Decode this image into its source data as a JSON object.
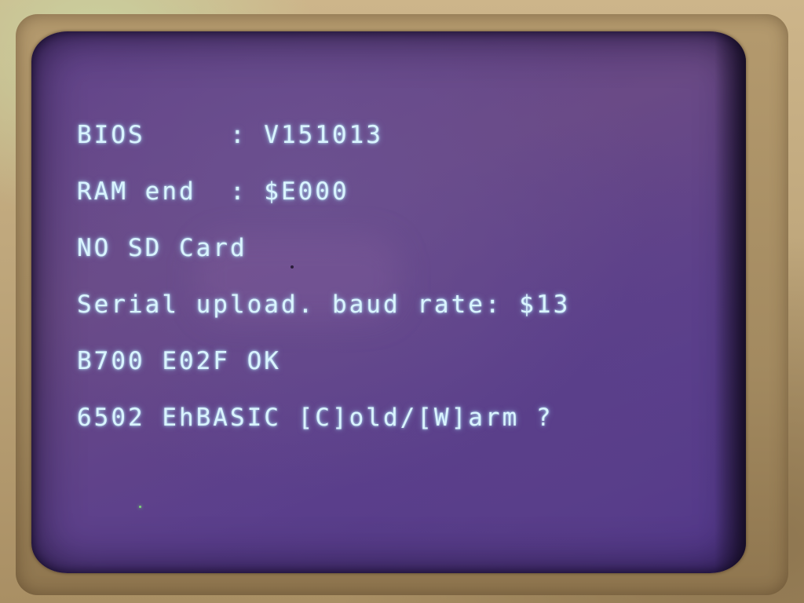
{
  "screen": {
    "lines": [
      "BIOS     : V151013",
      "RAM end  : $E000",
      "NO SD Card",
      "Serial upload. baud rate: $13",
      "B700 E02F OK",
      "6502 EhBASIC [C]old/[W]arm ?"
    ]
  },
  "colors": {
    "screen_background": "#5e3f88",
    "text": "#d9f4ff",
    "bezel": "#bea67b"
  }
}
